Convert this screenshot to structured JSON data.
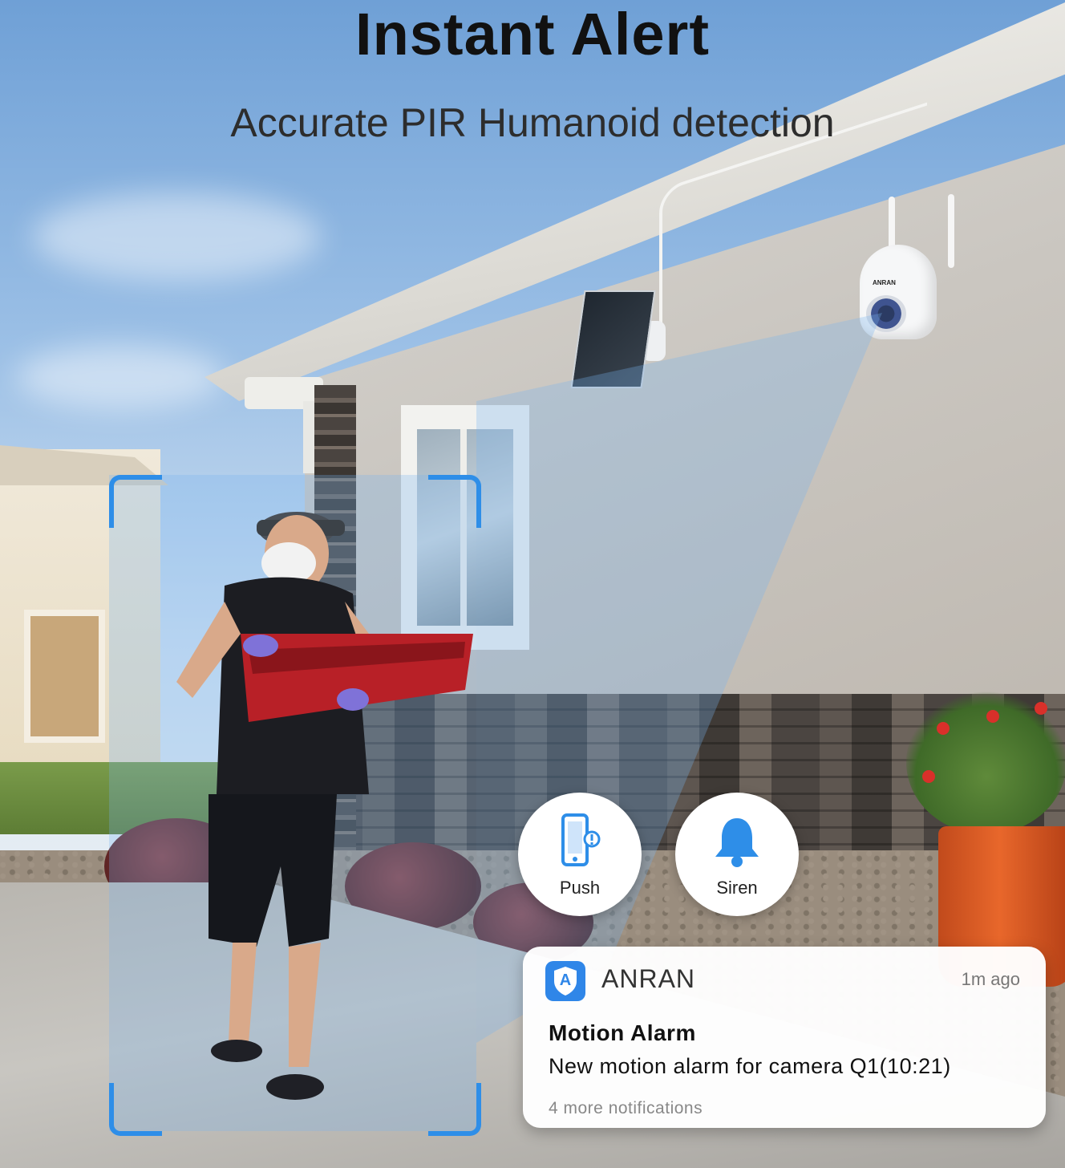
{
  "header": {
    "title": "Instant Alert",
    "subtitle": "Accurate PIR Humanoid detection"
  },
  "camera": {
    "brand": "ANRAN"
  },
  "features": [
    {
      "label": "Push",
      "icon": "smartphone-alert-icon"
    },
    {
      "label": "Siren",
      "icon": "bell-icon"
    }
  ],
  "notification": {
    "app_name": "ANRAN",
    "app_initial": "A",
    "time": "1m ago",
    "title": "Motion Alarm",
    "body": "New motion alarm for camera Q1(10:21)",
    "more": "4 more notifications"
  },
  "colors": {
    "accent": "#2e8ee8",
    "detection_overlay": "#78b4f0",
    "app_badge": "#2f86e8"
  }
}
